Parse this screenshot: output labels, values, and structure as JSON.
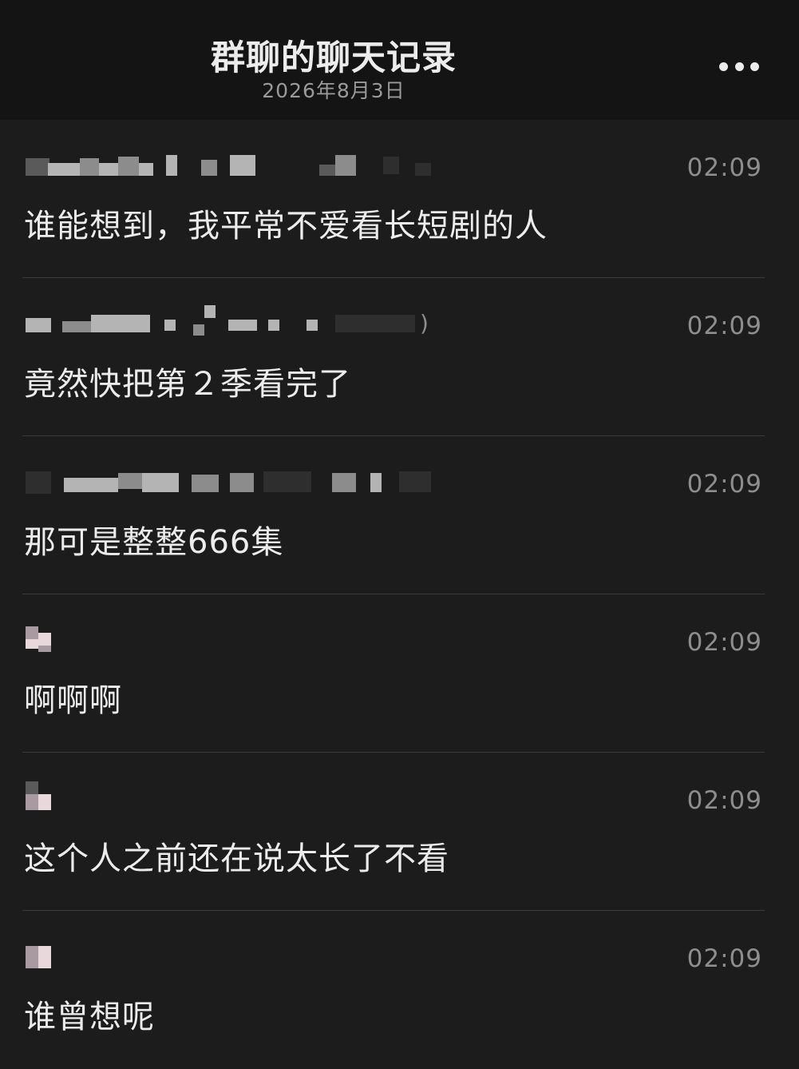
{
  "header": {
    "title": "群聊的聊天记录",
    "date": "2026年8月3日",
    "more_icon": "more-horizontal-icon"
  },
  "messages": [
    {
      "time": "02:09",
      "text": "谁能想到，我平常不爱看长短剧的人"
    },
    {
      "time": "02:09",
      "text": "竟然快把第２季看完了",
      "sender_suffix": ")"
    },
    {
      "time": "02:09",
      "text": "那可是整整666集"
    },
    {
      "time": "02:09",
      "text": "啊啊啊"
    },
    {
      "time": "02:09",
      "text": "这个人之前还在说太长了不看"
    },
    {
      "time": "02:09",
      "text": "谁曾想呢"
    }
  ]
}
